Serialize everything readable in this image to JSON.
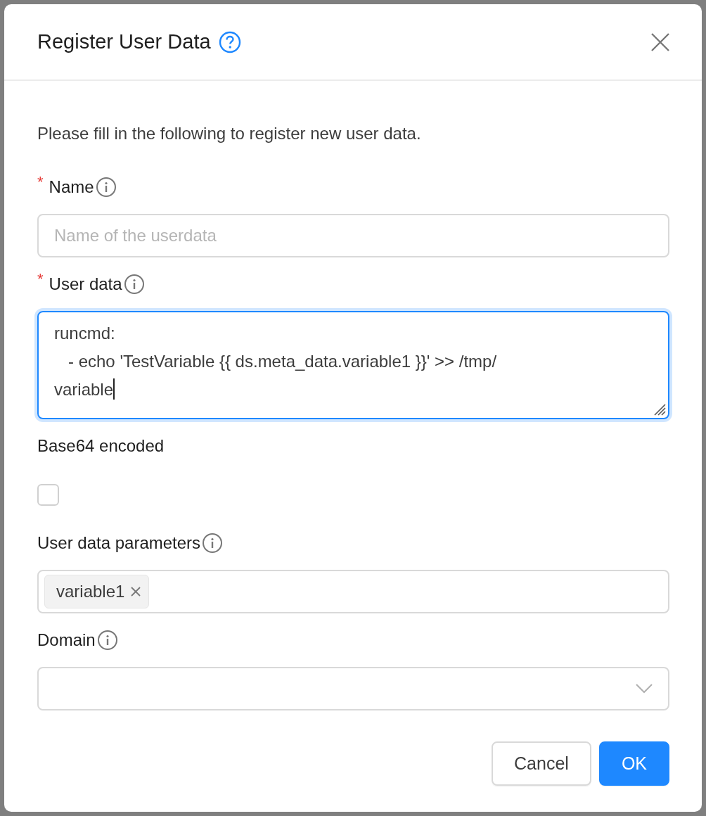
{
  "dialog": {
    "title": "Register User Data",
    "intro": "Please fill in the following to register new user data."
  },
  "fields": [
    {
      "kind": "text",
      "label": "Name",
      "required_mark": "*",
      "info": true,
      "focused": false,
      "placeholder": "Name of the userdata"
    },
    {
      "kind": "textarea",
      "label": "User data",
      "required_mark": "*",
      "info": true,
      "focused": true,
      "lines": [
        "runcmd:",
        "   - echo 'TestVariable {{ ds.meta_data.variable1 }}' >> /tmp/",
        "variable"
      ]
    },
    {
      "kind": "checkbox",
      "label": "Base64 encoded",
      "info": false,
      "focused": false,
      "checked": false
    },
    {
      "kind": "tags",
      "label": "User data parameters",
      "info": true,
      "focused": false,
      "tags": [
        "variable1"
      ]
    },
    {
      "kind": "select",
      "label": "Domain",
      "info": true,
      "focused": false
    }
  ],
  "buttons": [
    {
      "label": "Cancel",
      "primary": false
    },
    {
      "label": "OK",
      "primary": true
    }
  ]
}
